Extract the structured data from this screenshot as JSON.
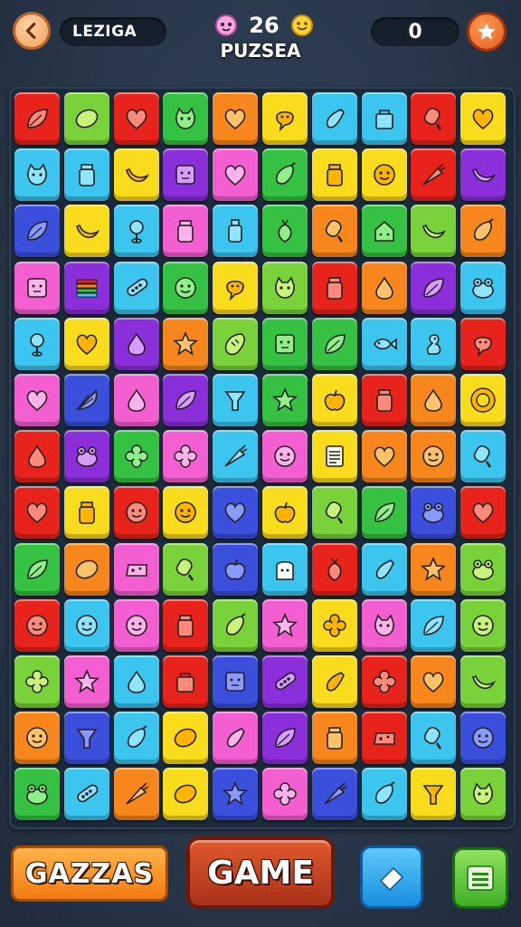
{
  "header": {
    "back_icon": "back-arrow-icon",
    "level_label": "LEZIGA",
    "avatar_icon": "pink-face-icon",
    "score": "26",
    "coin_icon": "smiley-coin-icon",
    "title": "PUZSEA",
    "points": "0",
    "star_icon": "star-icon"
  },
  "colors": {
    "red": "#e8231b",
    "lime": "#7ad23a",
    "yellow": "#f9dc1c",
    "cyan": "#3cc5ee",
    "purple": "#8a2fd9",
    "orange": "#f7871c",
    "pink": "#f35ed1",
    "green": "#35c243",
    "blue": "#3a4fdb"
  },
  "board": {
    "rows": [
      [
        {
          "c": "red",
          "i": "leaf"
        },
        {
          "c": "lime",
          "i": "lemon"
        },
        {
          "c": "red",
          "i": "heart"
        },
        {
          "c": "green",
          "i": "cat"
        },
        {
          "c": "orange",
          "i": "heart"
        },
        {
          "c": "yellow",
          "i": "bubble"
        },
        {
          "c": "cyan",
          "i": "eggplant"
        },
        {
          "c": "cyan",
          "i": "bag"
        },
        {
          "c": "red",
          "i": "popsicle"
        },
        {
          "c": "yellow",
          "i": "heart"
        }
      ],
      [
        {
          "c": "cyan",
          "i": "cat"
        },
        {
          "c": "cyan",
          "i": "jar"
        },
        {
          "c": "yellow",
          "i": "banana"
        },
        {
          "c": "purple",
          "i": "box"
        },
        {
          "c": "pink",
          "i": "heart"
        },
        {
          "c": "green",
          "i": "pepper"
        },
        {
          "c": "yellow",
          "i": "jar"
        },
        {
          "c": "yellow",
          "i": "smile"
        },
        {
          "c": "red",
          "i": "carrot"
        },
        {
          "c": "purple",
          "i": "banana"
        }
      ],
      [
        {
          "c": "blue",
          "i": "leaf"
        },
        {
          "c": "yellow",
          "i": "banana"
        },
        {
          "c": "cyan",
          "i": "lollipop"
        },
        {
          "c": "pink",
          "i": "jar"
        },
        {
          "c": "cyan",
          "i": "bottle"
        },
        {
          "c": "green",
          "i": "radish"
        },
        {
          "c": "orange",
          "i": "popsicle"
        },
        {
          "c": "green",
          "i": "house"
        },
        {
          "c": "lime",
          "i": "banana"
        },
        {
          "c": "orange",
          "i": "pepper"
        }
      ],
      [
        {
          "c": "pink",
          "i": "box"
        },
        {
          "c": "purple",
          "i": "stack"
        },
        {
          "c": "cyan",
          "i": "pod"
        },
        {
          "c": "green",
          "i": "smile"
        },
        {
          "c": "yellow",
          "i": "bubble"
        },
        {
          "c": "lime",
          "i": "cat"
        },
        {
          "c": "red",
          "i": "jar"
        },
        {
          "c": "orange",
          "i": "drop"
        },
        {
          "c": "purple",
          "i": "leaf"
        },
        {
          "c": "cyan",
          "i": "frog"
        }
      ],
      [
        {
          "c": "cyan",
          "i": "lollipop"
        },
        {
          "c": "yellow",
          "i": "heart"
        },
        {
          "c": "purple",
          "i": "drop"
        },
        {
          "c": "orange",
          "i": "star"
        },
        {
          "c": "lime",
          "i": "bread"
        },
        {
          "c": "green",
          "i": "box"
        },
        {
          "c": "green",
          "i": "leaf"
        },
        {
          "c": "cyan",
          "i": "fish"
        },
        {
          "c": "cyan",
          "i": "duck"
        },
        {
          "c": "red",
          "i": "bubble"
        }
      ],
      [
        {
          "c": "pink",
          "i": "heart"
        },
        {
          "c": "blue",
          "i": "fan"
        },
        {
          "c": "pink",
          "i": "drop"
        },
        {
          "c": "purple",
          "i": "leaf"
        },
        {
          "c": "cyan",
          "i": "cup"
        },
        {
          "c": "green",
          "i": "star"
        },
        {
          "c": "yellow",
          "i": "apple"
        },
        {
          "c": "red",
          "i": "jar"
        },
        {
          "c": "orange",
          "i": "drop"
        },
        {
          "c": "yellow",
          "i": "ring"
        }
      ],
      [
        {
          "c": "red",
          "i": "drop"
        },
        {
          "c": "purple",
          "i": "frog"
        },
        {
          "c": "green",
          "i": "flower"
        },
        {
          "c": "pink",
          "i": "flower"
        },
        {
          "c": "cyan",
          "i": "carrot"
        },
        {
          "c": "pink",
          "i": "smile"
        },
        {
          "c": "yellow",
          "i": "paper"
        },
        {
          "c": "orange",
          "i": "heart"
        },
        {
          "c": "orange",
          "i": "smile"
        },
        {
          "c": "cyan",
          "i": "popsicle"
        }
      ],
      [
        {
          "c": "red",
          "i": "heart"
        },
        {
          "c": "yellow",
          "i": "jar"
        },
        {
          "c": "red",
          "i": "smile"
        },
        {
          "c": "yellow",
          "i": "smile"
        },
        {
          "c": "blue",
          "i": "heart"
        },
        {
          "c": "yellow",
          "i": "apple"
        },
        {
          "c": "lime",
          "i": "popsicle"
        },
        {
          "c": "green",
          "i": "leaf"
        },
        {
          "c": "blue",
          "i": "frog"
        },
        {
          "c": "red",
          "i": "heart"
        }
      ],
      [
        {
          "c": "green",
          "i": "leaf"
        },
        {
          "c": "orange",
          "i": "lemon"
        },
        {
          "c": "pink",
          "i": "cheese"
        },
        {
          "c": "lime",
          "i": "popsicle"
        },
        {
          "c": "blue",
          "i": "apple"
        },
        {
          "c": "cyan",
          "i": "toast"
        },
        {
          "c": "red",
          "i": "radish"
        },
        {
          "c": "cyan",
          "i": "eggplant"
        },
        {
          "c": "orange",
          "i": "star"
        },
        {
          "c": "lime",
          "i": "frog"
        }
      ],
      [
        {
          "c": "red",
          "i": "smile"
        },
        {
          "c": "cyan",
          "i": "smile"
        },
        {
          "c": "pink",
          "i": "smile"
        },
        {
          "c": "red",
          "i": "jar"
        },
        {
          "c": "lime",
          "i": "pepper"
        },
        {
          "c": "pink",
          "i": "star"
        },
        {
          "c": "yellow",
          "i": "flower"
        },
        {
          "c": "pink",
          "i": "cat"
        },
        {
          "c": "cyan",
          "i": "leaf"
        },
        {
          "c": "lime",
          "i": "smile"
        }
      ],
      [
        {
          "c": "lime",
          "i": "flower"
        },
        {
          "c": "pink",
          "i": "star"
        },
        {
          "c": "cyan",
          "i": "drop"
        },
        {
          "c": "red",
          "i": "bag"
        },
        {
          "c": "blue",
          "i": "box"
        },
        {
          "c": "purple",
          "i": "pod"
        },
        {
          "c": "yellow",
          "i": "eggplant"
        },
        {
          "c": "red",
          "i": "flower"
        },
        {
          "c": "orange",
          "i": "heart"
        },
        {
          "c": "lime",
          "i": "banana"
        }
      ],
      [
        {
          "c": "orange",
          "i": "smile"
        },
        {
          "c": "blue",
          "i": "cup"
        },
        {
          "c": "cyan",
          "i": "pepper"
        },
        {
          "c": "yellow",
          "i": "lemon"
        },
        {
          "c": "pink",
          "i": "eggplant"
        },
        {
          "c": "purple",
          "i": "leaf"
        },
        {
          "c": "orange",
          "i": "jar"
        },
        {
          "c": "red",
          "i": "cheese"
        },
        {
          "c": "cyan",
          "i": "popsicle"
        },
        {
          "c": "blue",
          "i": "smile"
        }
      ],
      [
        {
          "c": "green",
          "i": "frog"
        },
        {
          "c": "cyan",
          "i": "pod"
        },
        {
          "c": "orange",
          "i": "carrot"
        },
        {
          "c": "yellow",
          "i": "lemon"
        },
        {
          "c": "blue",
          "i": "star"
        },
        {
          "c": "pink",
          "i": "flower"
        },
        {
          "c": "blue",
          "i": "carrot"
        },
        {
          "c": "cyan",
          "i": "pepper"
        },
        {
          "c": "yellow",
          "i": "cup"
        },
        {
          "c": "lime",
          "i": "cat"
        }
      ]
    ]
  },
  "footer": {
    "left_label": "GAZZAS",
    "game_label": "GAME",
    "eraser_icon": "eraser-icon",
    "menu_icon": "menu-list-icon"
  }
}
